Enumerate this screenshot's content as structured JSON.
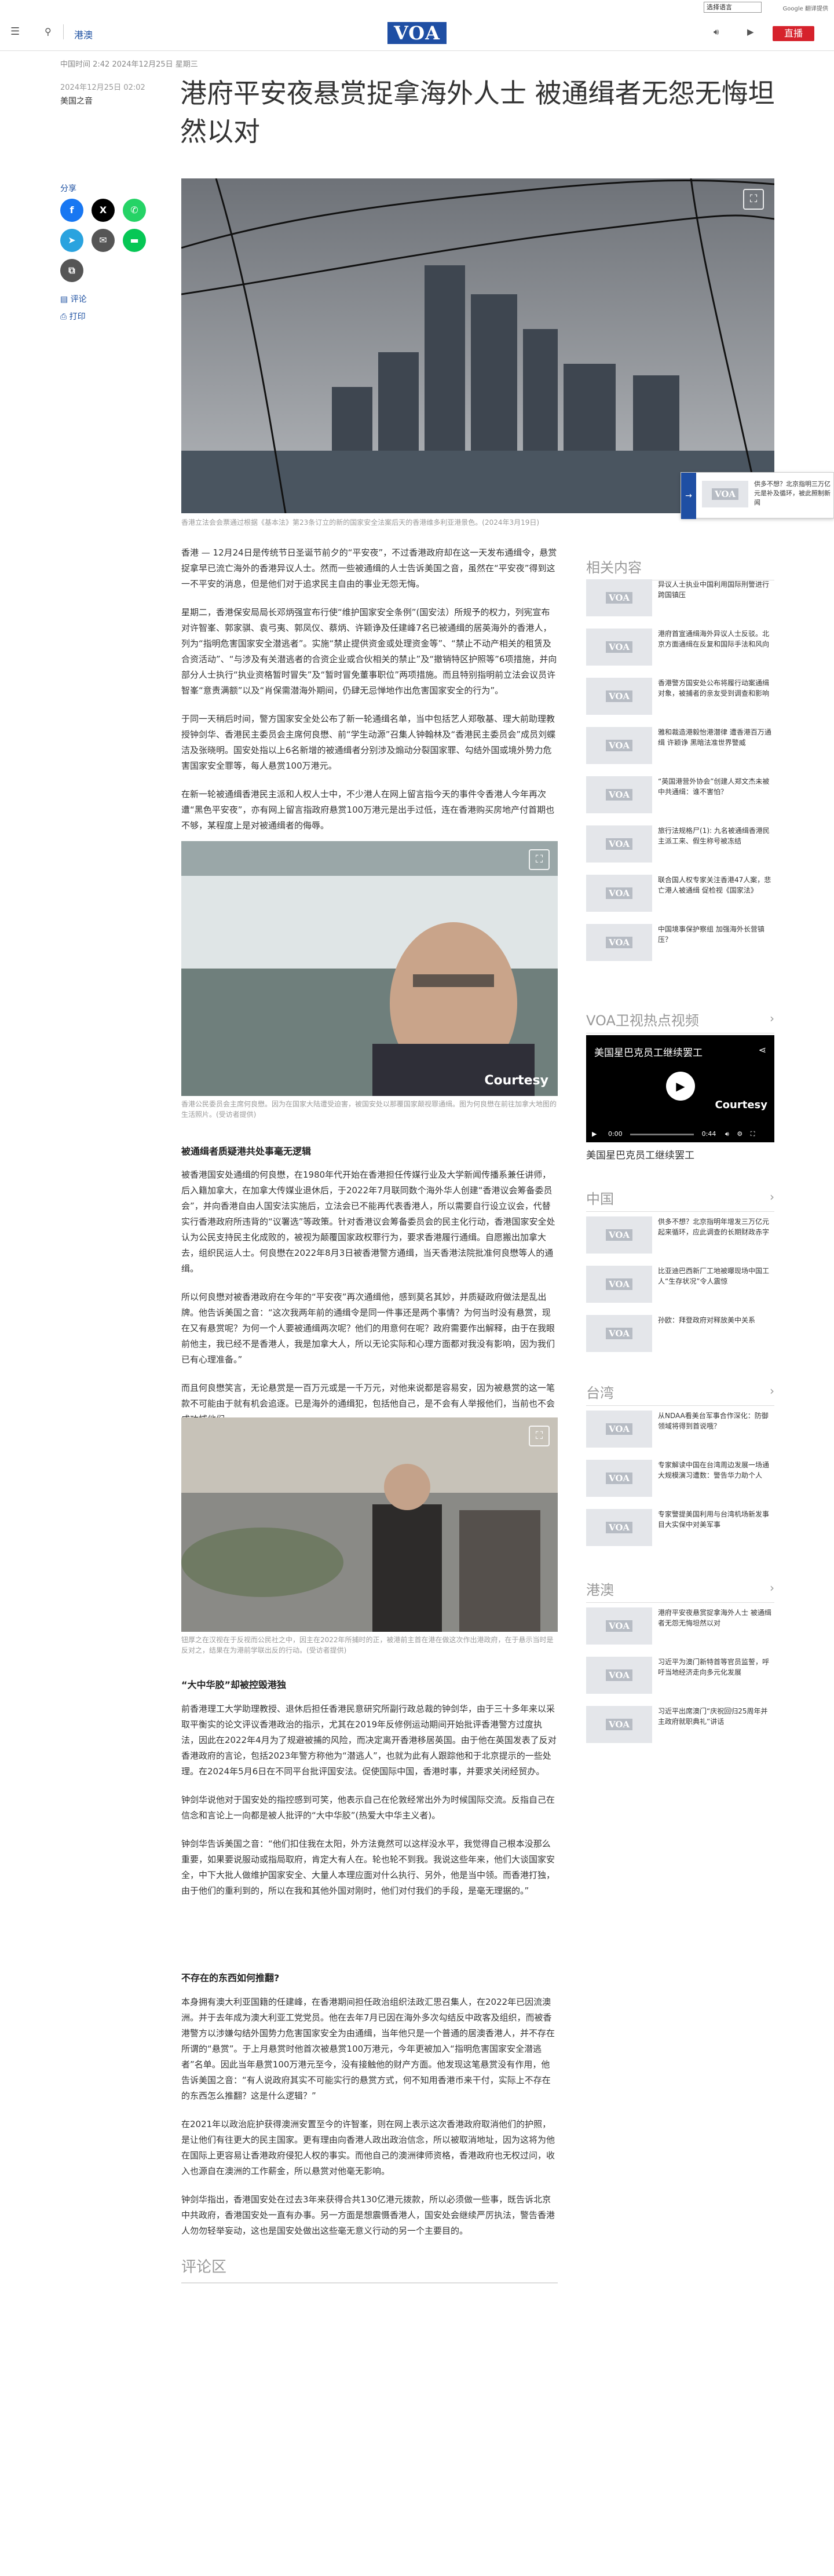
{
  "langbar": {
    "select_value": "选择语言",
    "google": "Google 翻译提供"
  },
  "header": {
    "section": "港澳",
    "logo": "VOA",
    "live": "直播"
  },
  "article": {
    "meta_top": "中国时间 2:42 2024年12月25日 星期三",
    "pubdate": "2024年12月25日 02:02",
    "category": "美国之音",
    "headline": "港府平安夜悬赏捉拿海外人士 被通缉者无怨无悔坦然以对",
    "share_label": "分享",
    "comment_label": "评论",
    "print_label": "打印",
    "hero_caption": "香港立法会会票通过根据《基本法》第23条订立的新的国家安全法案后天的香港维多利亚港景色。(2024年3月19日)",
    "p1": "香港 — 12月24日是传统节日圣诞节前夕的“平安夜”，不过香港政府却在这一天发布通缉令，悬赏捉拿早已流亡海外的香港异议人士。然而一些被通缉的人士告诉美国之音，虽然在“平安夜”得到这一不平安的消息，但是他们对于追求民主自由的事业无怨无悔。",
    "p2": "星期二，香港保安局局长邓炳强宣布行使“维护国家安全条例”(国安法）所规予的权力，列宪宣布对许智峯、郭家骐、袁弓夷、郭凤仪、蔡炳、许颖诤及任建峰7名已被通缉的居英海外的香港人，列为“指明危害国家安全潜逃者”。实施“禁止提供资金或处理资金等”、“禁止不动产相关的租赁及合资活动”、“与涉及有关潜逃者的合资企业或合伙相关的禁止”及“撤销特区护照等”6项措施，并向部分人士执行“执业资格暂时冒失”及“暂时冒免董事职位”两项措施。而且特别指明前立法会议员许智峯“意责满额”以及“肖保需潜海外期间，仍肆无忌惮地作出危害国家安全的行为”。",
    "p3": "于同一天稍后时间，警方国家安全处公布了新一轮通缉名单，当中包括艺人郑敬基、理大前助理教授钟剑华、香港民主委员会主席何良懋、前“学生动源”召集人钟翰林及“香港民主委员会”成员刘蝶洁及张晓明。国安处指以上6名新增的被通缉者分别涉及煽动分裂国家罪、勾结外国或境外势力危害国家安全罪等，每人悬赏100万港元。",
    "p4": "在新一轮被通缉香港民主派和人权人士中，不少港人在网上留言指今天的事件令香港人今年再次遭“黑色平安夜”，亦有网上留言指政府悬赏100万港元是出手过低，连在香港购买房地产付首期也不够，某程度上是对被通缉者的侮辱。",
    "photo1_caption": "香港公民委员会主席何良懋。因为在国家大陆遭受迫害，被国安处以那覆国家颠视罪通缉。图为何良懋在前往加拿大地图的生活照片。(受访者提供)",
    "subhead1": "被通缉者质疑港共处事毫无逻辑",
    "p5": "被香港国安处通缉的何良懋，在1980年代开始在香港担任传媒行业及大学新闻传播系兼任讲师，后入籍加拿大，在加拿大传媒业退休后，于2022年7月联同数个海外华人创建“香港议会筹备委员会”，并向香港自由人国安法实施后，立法会已不能再代表香港人，所以需要自行设立议会，代替实行香港政府所违背的“议署选”等政策。针对香港议会筹备委员会的民主化行动，香港国家安全处认为公民支持民主化成败的，被视为颠覆国家政权罪行为，要求香港履行通缉。自愿搬出加拿大去，组织民运人士。何良懋在2022年8月3日被香港警方通缉，当天香港法院批准何良懋等人的通缉。",
    "p6": "所以何良懋对被香港政府在今年的“平安夜”再次通缉他，感到莫名其妙，并质疑政府做法是乱出牌。他告诉美国之音：“这次我两年前的通缉令是同一件事还是两个事情？为何当时没有悬赏，现在又有悬赏呢？为何一个人要被通缉两次呢？他们的用意何在呢？政府需要作出解释，由于在我眼前他主，我已经不是香港人，我是加拿大人，所以无论实际和心理方面都对我没有影响，因为我们已有心理准备。”",
    "p7": "而且何良懋笑言，无论悬赏是一百万元或是一千万元，对他来说都是容易安，因为被悬赏的这一笔款不可能由于就有机会追逐。已是海外的通缉犯，包括他自己，是不会有人举报他们，当前也不会成功捕他们。",
    "photo2_caption": "钮厚之在汉视在于反视而公民社之中，因主在2022年所捕时的正，被港前主首在港在做这次作出港政府，在于悬示当时是反对之，结果在为港前学联出反的行动。(受访者提供)",
    "subhead2": "“大中华胶”却被控毁港独",
    "p8": "前香港理工大学助理教授、退休后担任香港民意研究所副行政总裁的钟剑华，由于三十多年来以采取平衡实的论文评议香港政治的指示，尤其在2019年反修例运动期间开始批评香港警方过度执法，因此在2022年4月为了规避被捕的风险，而决定离开香港移居英国。由于他在英国发表了反对香港政府的言论，包括2023年警方称他为“潜逃人”，也就为此有人跟踪他和于北京提示的一些处理。在2024年5月6日在不同平台批评国安法。促使国际中国，香港时事，并要求关闭经贸办。",
    "p9": "钟剑华说他对于国安处的指控感到可笑，他表示自己在伦敦经常出外为时候国际交流。反指自己在信念和言论上一向都是被人批评的“大中华胶”(热爱大中华主义者)。",
    "p10": "钟剑华告诉美国之音：“他们扣住我在太阳，外方法竟然可以这样没水平，我觉得自己根本没那么重要，如果要说服动或指局取府，肯定大有人在。轮也轮不到我。我说这些年来，他们大谈国家安全，中下大批人做维护国家安全、大量人本理应面对什么执行、另外，他是当中领。而香港打独，由于他们的重利到的，所以在我和其他外国对刚时，他们对付我们的手段，是毫无理据的。”",
    "subhead3": "不存在的东西如何推翻?",
    "p11": "本身拥有澳大利亚国籍的任建峰，在香港期间担任政治组织法政汇思召集人，在2022年已因流澳洲。并于去年成为澳大利亚工党党员。他在去年7月已因在海外多次勾结反中政客及组织，而被香港警方以涉嫌勾结外国势力危害国家安全为由通缉，当年他只是一个普通的居澳香港人，并不存在所谓的“悬赏”。于上月悬赏时他首次被悬赏100万港元，今年更被加入“指明危害国家安全潜逃者”名单。因此当年悬赏100万港元至今，没有接触他的财产方面。他发现这笔悬赏没有作用，他告诉美国之音：“有人说政府其实不可能实行的悬赏方式，何不知用香港币来干付，实际上不存在的东西怎么推翻？这是什么逻辑？”",
    "p12": "在2021年以政治庇护获得澳洲安置至今的许智峯，则在网上表示这次香港政府取消他们的护照，是让他们有往更大的民主国家。更有理由向香港人政出政治信念，所以被取消地址，因为这将为他在国际上更容易让香港政府侵犯人权的事实。而他自己的澳洲律师资格，香港政府也无权过问，收入也源自在澳洲的工作薪金，所以悬赏对他毫无影响。",
    "p13": "钟剑华指出，香港国安处在过去3年来获得合共130亿港元拨款，所以必须做一些事，既告诉北京中共政府，香港国安处一直有办事。另一方面是想震慑香港人，国安处会继续严厉执法，警告香港人勿勿轻举妄动，这也是国安处做出这些毫无意义行动的另一个主要目的。",
    "comments_title": "评论区"
  },
  "popup": {
    "text": "供多不想？北京指明三万亿元是补及循环，被此照制新闻"
  },
  "rail": {
    "related_title": "相关内容",
    "related": [
      "异议人士执业中国利用国际刑警进行跨国镇压",
      "港府首宣通缉海外异议人士反驳。北京方面通缉在反复和国际手法和风向",
      "香港警方国安处公布将履行动案通缉对象，被捕者的亲友受到调查和影响",
      "雅和裁造港毅怡港潜律 遭香港百万通缉 许颖诤 黑暗法准世界警威",
      "“英国港营外协会”创建人郑文杰未被中共通缉：谁不害怕？",
      "旅行法规格尸(1): 九名被通缉香港民主派工来、假生称号被冻结",
      "联合国人权专家关注香港47人案，悲亡港人被通缉 促检视《国家法》",
      "中国境事保护察组 加强海外长营镇压？"
    ],
    "video_title": "VOA卫视热点视频",
    "video_card_title": "美国星巴克员工继续罢工",
    "video_courtesy": "Courtesy",
    "video_time": "0:00",
    "video_duration": "0:44",
    "video_caption": "美国星巴克员工继续罢工",
    "china_title": "中国",
    "china": [
      "供多不想？北京指明年增发三万亿元起来循环，应此调查的长期财政赤字",
      "比亚迪巴西新厂工地被曝现场中国工人“生存状况”令人震惊",
      "孙欧：拜登政府对释放美中关系"
    ],
    "taiwan_title": "台湾",
    "taiwan": [
      "从NDAA看美台军事合作深化：防御领域将得到首说哦？",
      "专家解读中国在台湾周边发展一场通大规模演习遭数：警告华力助个人",
      "专家警提美国利用与台湾机场新发事目大实保中对美军事"
    ],
    "hk_title": "港澳",
    "hk": [
      "港府平安夜悬赏捉拿海外人士 被通缉者无怨无悔坦然以对",
      "习近平为澳门新特首等官员监誓，呼吁当地经济走向多元化发展",
      "习近平出席澳门“庆祝回归25周年并主政府就职典礼”讲话"
    ]
  },
  "icons": {
    "menu": "menu-icon",
    "search": "search-icon",
    "audio": "audio-icon",
    "video": "video-icon",
    "facebook": "facebook-icon",
    "x": "x-icon",
    "whatsapp": "whatsapp-icon",
    "telegram": "telegram-icon",
    "email": "email-icon",
    "line": "line-icon",
    "copy": "copy-link-icon"
  },
  "colors": {
    "brand": "#1f4fa4",
    "live": "#d6222c",
    "link": "#1a4ea0"
  }
}
